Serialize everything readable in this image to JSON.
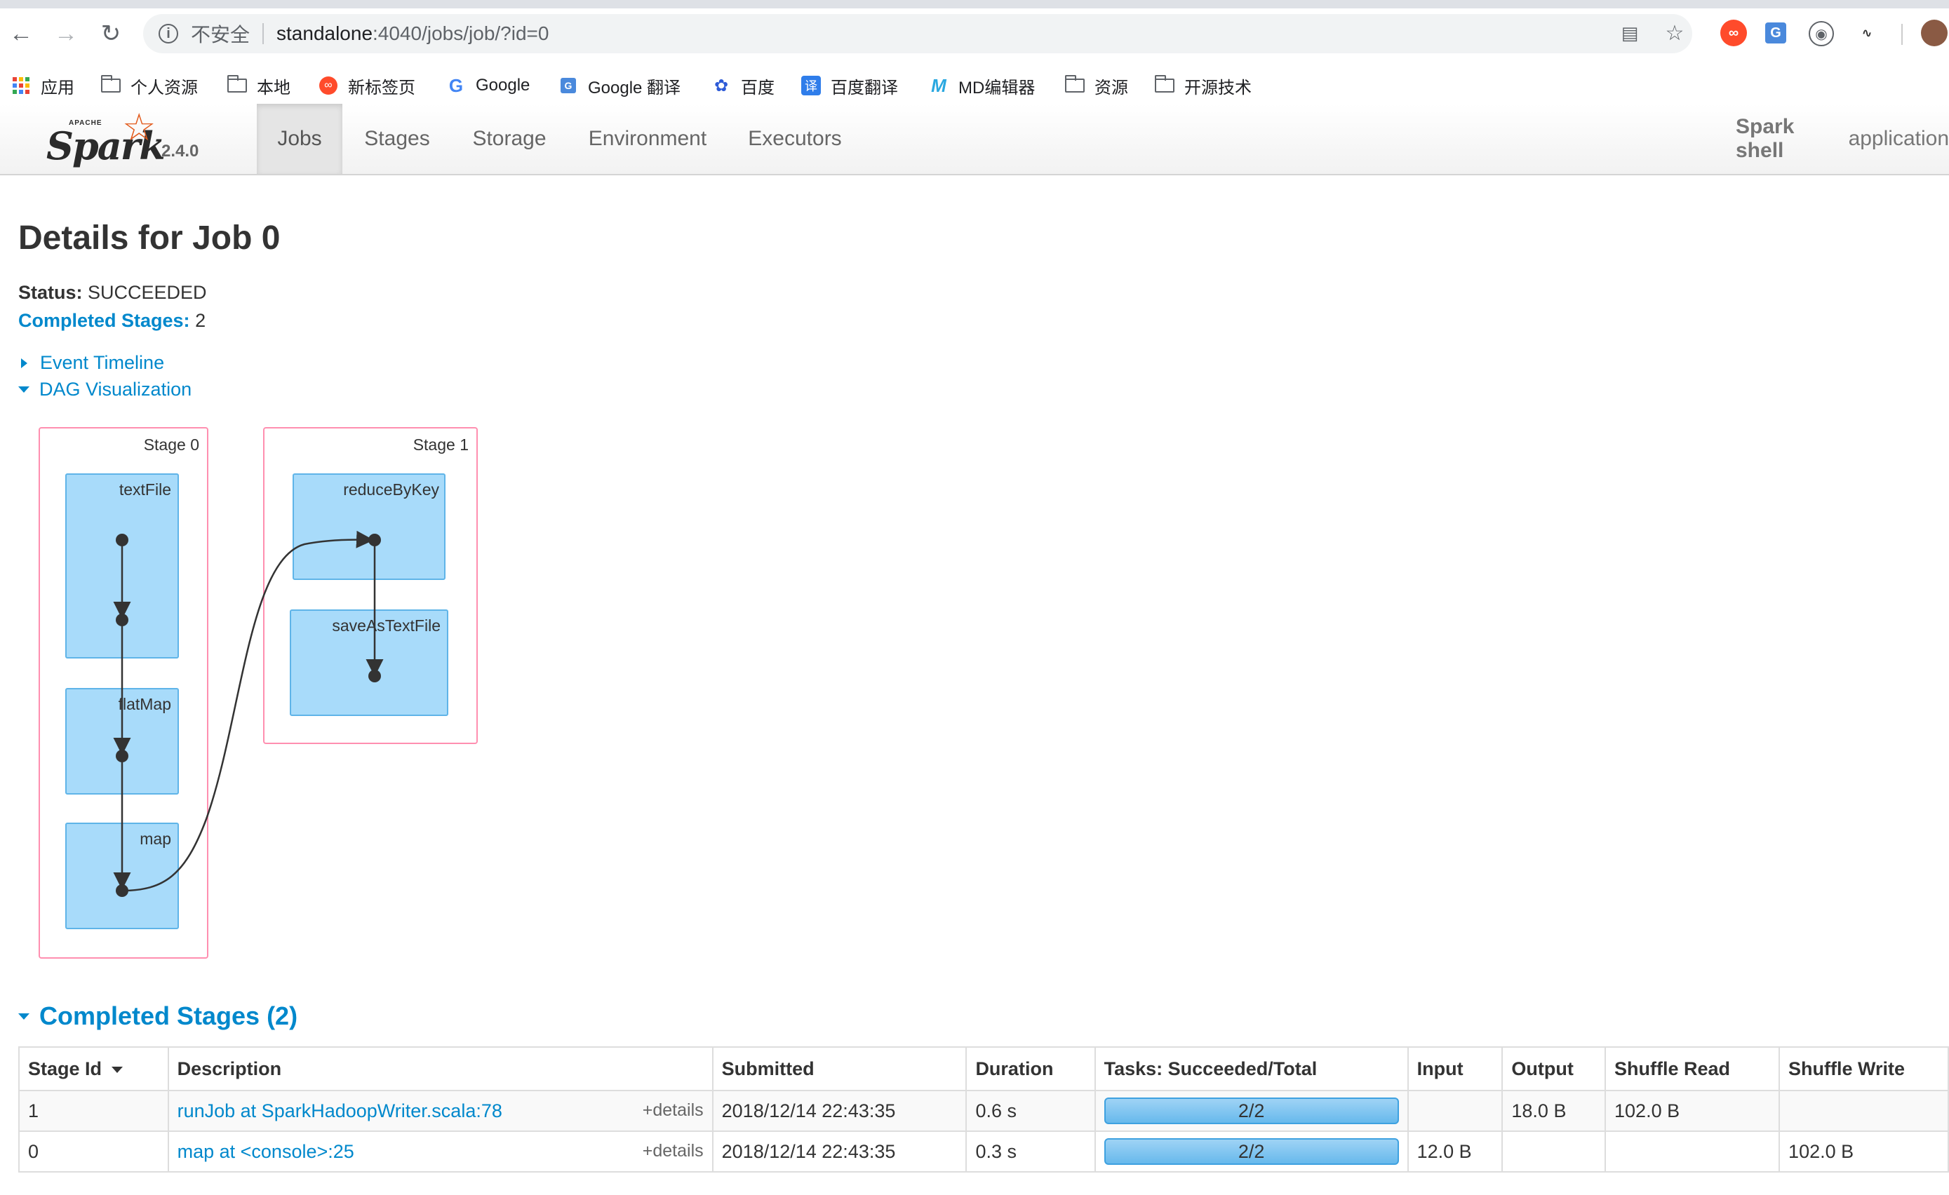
{
  "browser": {
    "security_label": "不安全",
    "url_host": "standalone",
    "url_path": ":4040/jobs/job/?id=0",
    "bookmarks": [
      "应用",
      "个人资源",
      "本地",
      "新标签页",
      "Google",
      "Google 翻译",
      "百度",
      "百度翻译",
      "MD编辑器",
      "资源",
      "开源技术"
    ]
  },
  "navbar": {
    "version": "2.4.0",
    "tabs": [
      "Jobs",
      "Stages",
      "Storage",
      "Environment",
      "Executors"
    ],
    "active_tab": "Jobs",
    "app_name_bold": "Spark shell",
    "app_name_rest": "application"
  },
  "page": {
    "title": "Details for Job 0",
    "status_label": "Status:",
    "status_value": "SUCCEEDED",
    "completed_label": "Completed Stages:",
    "completed_value": "2",
    "event_timeline": "Event Timeline",
    "dag_visualization": "DAG Visualization"
  },
  "dag": {
    "stages": [
      {
        "label": "Stage 0",
        "ops": [
          "textFile",
          "flatMap",
          "map"
        ]
      },
      {
        "label": "Stage 1",
        "ops": [
          "reduceByKey",
          "saveAsTextFile"
        ]
      }
    ]
  },
  "completed_stages": {
    "heading": "Completed Stages (2)",
    "columns": [
      "Stage Id",
      "Description",
      "Submitted",
      "Duration",
      "Tasks: Succeeded/Total",
      "Input",
      "Output",
      "Shuffle Read",
      "Shuffle Write"
    ],
    "details_label": "+details",
    "rows": [
      {
        "id": "1",
        "description": "runJob at SparkHadoopWriter.scala:78",
        "submitted": "2018/12/14 22:43:35",
        "duration": "0.6 s",
        "tasks": "2/2",
        "tasks_fraction": 1.0,
        "input": "",
        "output": "18.0 B",
        "shuffle_read": "102.0 B",
        "shuffle_write": ""
      },
      {
        "id": "0",
        "description": "map at <console>:25",
        "submitted": "2018/12/14 22:43:35",
        "duration": "0.3 s",
        "tasks": "2/2",
        "tasks_fraction": 1.0,
        "input": "12.0 B",
        "output": "",
        "shuffle_read": "",
        "shuffle_write": "102.0 B"
      }
    ]
  },
  "colors": {
    "link": "#0088cc",
    "stage_border": "#ff7f9f",
    "rdd_fill": "#a8dbfa",
    "rdd_border": "#5fb4e8",
    "progress": "#67b9ec"
  }
}
